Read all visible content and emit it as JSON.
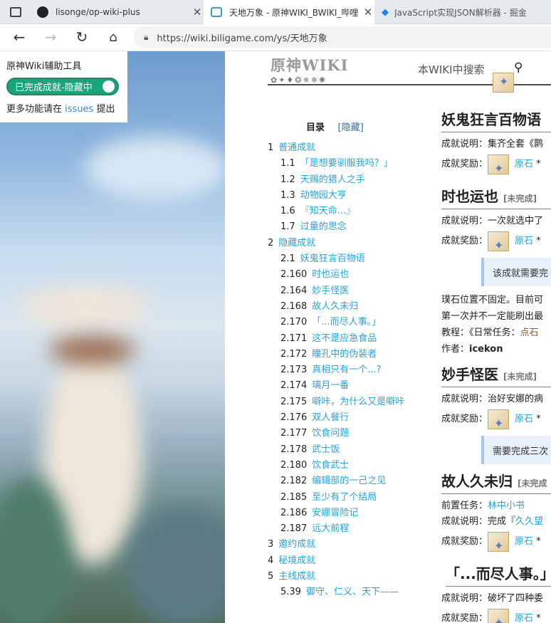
{
  "browser": {
    "tabs": [
      {
        "title": "lisonge/op-wiki-plus",
        "icon": "github-icon"
      },
      {
        "title": "天地万象 - 原神WIKI_BWIKI_哔哩",
        "icon": "bilibili-icon"
      },
      {
        "title": "JavaScript实现JSON解析器 - 掘金",
        "icon": "juejin-icon"
      }
    ],
    "url": "https://wiki.biligame.com/ys/天地万象"
  },
  "helper": {
    "title": "原神Wiki辅助工具",
    "toggle_label": "已完成成就-隐藏中",
    "more_prefix": "更多功能请在",
    "issues_link": "issues",
    "more_suffix": "提出"
  },
  "wiki": {
    "logo_text": "原神WIKI",
    "search_hint": "本WIKI中搜索"
  },
  "toc": {
    "title": "目录",
    "hide_label": "[隐藏]",
    "items": [
      {
        "num": "1",
        "label": "普通成就",
        "level": 1
      },
      {
        "num": "1.1",
        "label": "「是想要驯服我吗？」",
        "level": 2
      },
      {
        "num": "1.2",
        "label": "天赐的猎人之手",
        "level": 2
      },
      {
        "num": "1.3",
        "label": "动物园大亨",
        "level": 2
      },
      {
        "num": "1.6",
        "label": "『知天命...』",
        "level": 2
      },
      {
        "num": "1.7",
        "label": "过量的思念",
        "level": 2
      },
      {
        "num": "2",
        "label": "隐藏成就",
        "level": 1
      },
      {
        "num": "2.1",
        "label": "妖鬼狂言百物语",
        "level": 2
      },
      {
        "num": "2.160",
        "label": "时也运也",
        "level": 2
      },
      {
        "num": "2.164",
        "label": "妙手怪医",
        "level": 2
      },
      {
        "num": "2.168",
        "label": "故人久未归",
        "level": 2
      },
      {
        "num": "2.170",
        "label": "「...而尽人事。」",
        "level": 2
      },
      {
        "num": "2.171",
        "label": "这不是应急食品",
        "level": 2
      },
      {
        "num": "2.172",
        "label": "瞳孔中的伪装者",
        "level": 2
      },
      {
        "num": "2.173",
        "label": "真相只有一个...?",
        "level": 2
      },
      {
        "num": "2.174",
        "label": "璃月一番",
        "level": 2
      },
      {
        "num": "2.175",
        "label": "噼咔，为什么又是噼咔",
        "level": 2
      },
      {
        "num": "2.176",
        "label": "双人餐行",
        "level": 2
      },
      {
        "num": "2.177",
        "label": "饮食问题",
        "level": 2
      },
      {
        "num": "2.178",
        "label": "武士饭",
        "level": 2
      },
      {
        "num": "2.180",
        "label": "饮食武士",
        "level": 2
      },
      {
        "num": "2.182",
        "label": "编辑部的一己之见",
        "level": 2
      },
      {
        "num": "2.185",
        "label": "至少有了个结局",
        "level": 2
      },
      {
        "num": "2.186",
        "label": "安娜冒险记",
        "level": 2
      },
      {
        "num": "2.187",
        "label": "远大前程",
        "level": 2
      },
      {
        "num": "3",
        "label": "邀约成就",
        "level": 1
      },
      {
        "num": "4",
        "label": "秘境成就",
        "level": 1
      },
      {
        "num": "5",
        "label": "主线成就",
        "level": 1
      },
      {
        "num": "5.39",
        "label": "御守、仁义、天下——",
        "level": 2
      }
    ]
  },
  "content": {
    "s1": {
      "title": "妖鬼狂言百物语",
      "desc_label": "成就说明：",
      "desc": "集齐全套《鹮",
      "reward_label": "成就奖励：",
      "reward": "原石",
      "star": "*"
    },
    "s2": {
      "title": "时也运也",
      "badge": "[未完成]",
      "desc_label": "成就说明：",
      "desc": "一次就选中了",
      "reward_label": "成就奖励：",
      "reward": "原石",
      "star": "*",
      "note": "该成就需要完",
      "line1": "璞石位置不固定。目前可",
      "line2": "第一次并不一定能刷出最",
      "tutorial_label": "教程：",
      "tutorial": "《日常任务：",
      "tutorial_link": "点石",
      "author_label": "作者：",
      "author": "icekon"
    },
    "s3": {
      "title": "妙手怪医",
      "badge": "[未完成]",
      "desc_label": "成就说明：",
      "desc": "治好安娜的病",
      "reward_label": "成就奖励：",
      "reward": "原石",
      "star": "*",
      "note": "需要完成三次"
    },
    "s4": {
      "title": "故人久未归",
      "badge": "[未完成",
      "pre_label": "前置任务：",
      "pre": "林中小书",
      "desc_label": "成就说明：",
      "desc": "完成『",
      "desc_link": "久久望",
      "reward_label": "成就奖励：",
      "reward": "原石",
      "star": "*"
    },
    "s5": {
      "title": "「...而尽人事。」",
      "desc_label": "成就说明：",
      "desc": "破坏了四种委",
      "reward_label": "成就奖励：",
      "reward": "原石",
      "star": "*"
    }
  }
}
